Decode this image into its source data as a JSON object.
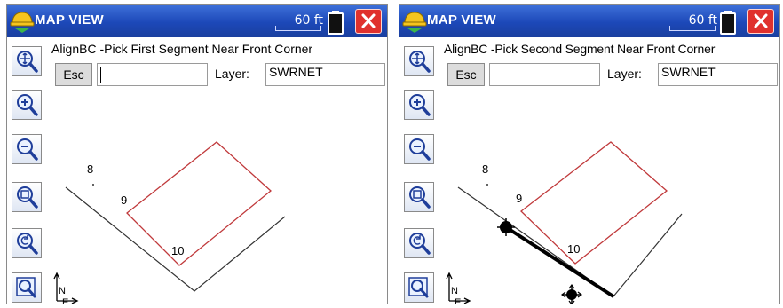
{
  "panels": [
    {
      "title": "MAP VIEW",
      "scale": "60 ft",
      "prompt": "AlignBC -Pick First Segment Near Front Corner",
      "esc_label": "Esc",
      "command_value": "",
      "layer_label": "Layer:",
      "layer_value": "SWRNET",
      "points": [
        "8",
        "9",
        "10"
      ],
      "axis_labels": {
        "north": "N",
        "east": "E"
      },
      "selected_segment": false
    },
    {
      "title": "MAP VIEW",
      "scale": "60 ft",
      "prompt": "AlignBC -Pick Second Segment Near Front Corner",
      "esc_label": "Esc",
      "command_value": "",
      "layer_label": "Layer:",
      "layer_value": "SWRNET",
      "points": [
        "8",
        "9",
        "10"
      ],
      "axis_labels": {
        "north": "N",
        "east": "E"
      },
      "selected_segment": true
    }
  ],
  "toolbar_icons": [
    "zoom-extents-icon",
    "zoom-in-icon",
    "zoom-out-icon",
    "zoom-window-icon",
    "zoom-previous-icon",
    "map-select-icon"
  ],
  "colors": {
    "titlebar": "#1c48b8",
    "close": "#e0312d",
    "lot_outline": "#c0393b",
    "linework": "#333333"
  }
}
